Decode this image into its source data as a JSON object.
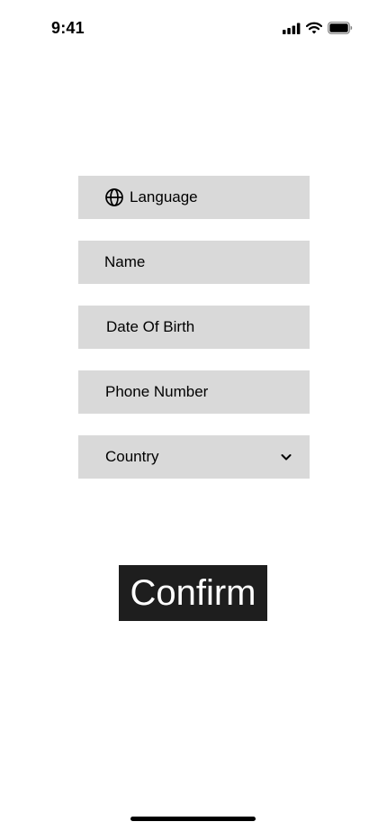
{
  "status_bar": {
    "time": "9:41",
    "icons": [
      "cellular-signal-icon",
      "wifi-icon",
      "battery-icon"
    ]
  },
  "form": {
    "language": {
      "label": "Language",
      "icon": "globe-icon"
    },
    "name": {
      "label": "Name"
    },
    "date_of_birth": {
      "label": "Date Of Birth"
    },
    "phone_number": {
      "label": "Phone Number"
    },
    "country": {
      "label": "Country",
      "icon": "chevron-down-icon"
    }
  },
  "confirm_button": {
    "label": "Confirm"
  },
  "colors": {
    "field_background": "#d9d9d9",
    "button_background": "#1e1e1e",
    "button_text": "#ffffff",
    "page_background": "#ffffff"
  }
}
